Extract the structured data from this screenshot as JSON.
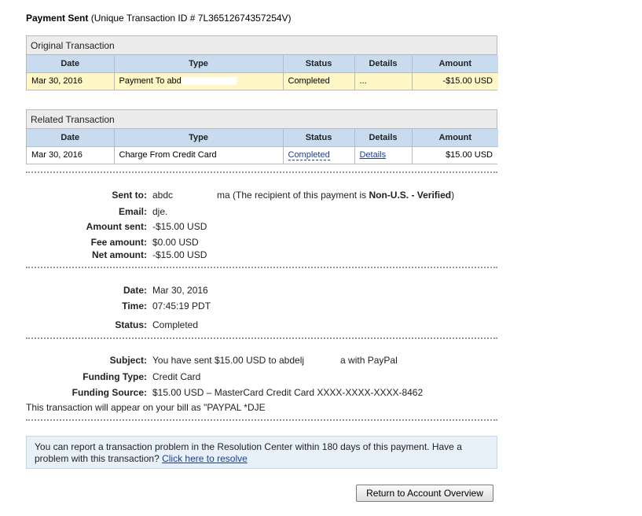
{
  "header": {
    "title": "Payment Sent",
    "id_text": "(Unique Transaction ID # 7L36512674357254V)"
  },
  "original": {
    "caption": "Original Transaction",
    "columns": [
      "Date",
      "Type",
      "Status",
      "Details",
      "Amount"
    ],
    "row": {
      "date": "Mar 30, 2016",
      "type": "Payment To abd",
      "status": "Completed",
      "details": "...",
      "amount": "-$15.00 USD"
    }
  },
  "related": {
    "caption": "Related Transaction",
    "columns": [
      "Date",
      "Type",
      "Status",
      "Details",
      "Amount"
    ],
    "row": {
      "date": "Mar 30, 2016",
      "type": "Charge From Credit Card",
      "status": "Completed",
      "details": "Details",
      "amount": "$15.00 USD"
    }
  },
  "payment": {
    "sent_to_label": "Sent to:",
    "sent_to_value": "abdc",
    "sent_to_mid": "ma (The recipient of this payment is ",
    "sent_to_status": "Non-U.S. - Verified",
    "sent_to_end": ")",
    "email_label": "Email:",
    "email_value": "dje.",
    "amount_sent_label": "Amount sent:",
    "amount_sent_value": "-$15.00 USD",
    "fee_label": "Fee amount:",
    "fee_value": "$0.00 USD",
    "net_label": "Net amount:",
    "net_value": "-$15.00 USD"
  },
  "timing": {
    "date_label": "Date:",
    "date_value": "Mar 30, 2016",
    "time_label": "Time:",
    "time_value": "07:45:19 PDT",
    "status_label": "Status:",
    "status_value": "Completed"
  },
  "funding": {
    "subject_label": "Subject:",
    "subject_value_start": "You have sent $15.00 USD to abdelj",
    "subject_value_end": "a with PayPal",
    "type_label": "Funding Type:",
    "type_value": "Credit Card",
    "source_label": "Funding Source:",
    "source_value": "$15.00 USD – MasterCard Credit Card XXXX-XXXX-XXXX-8462",
    "bill_text": "This transaction will appear on your bill as \"PAYPAL *DJE"
  },
  "notice": {
    "text": "You can report a transaction problem in the Resolution Center within 180 days of this payment. Have a problem with this transaction?",
    "link": "Click here to resolve"
  },
  "return_button": "Return to Account Overview"
}
